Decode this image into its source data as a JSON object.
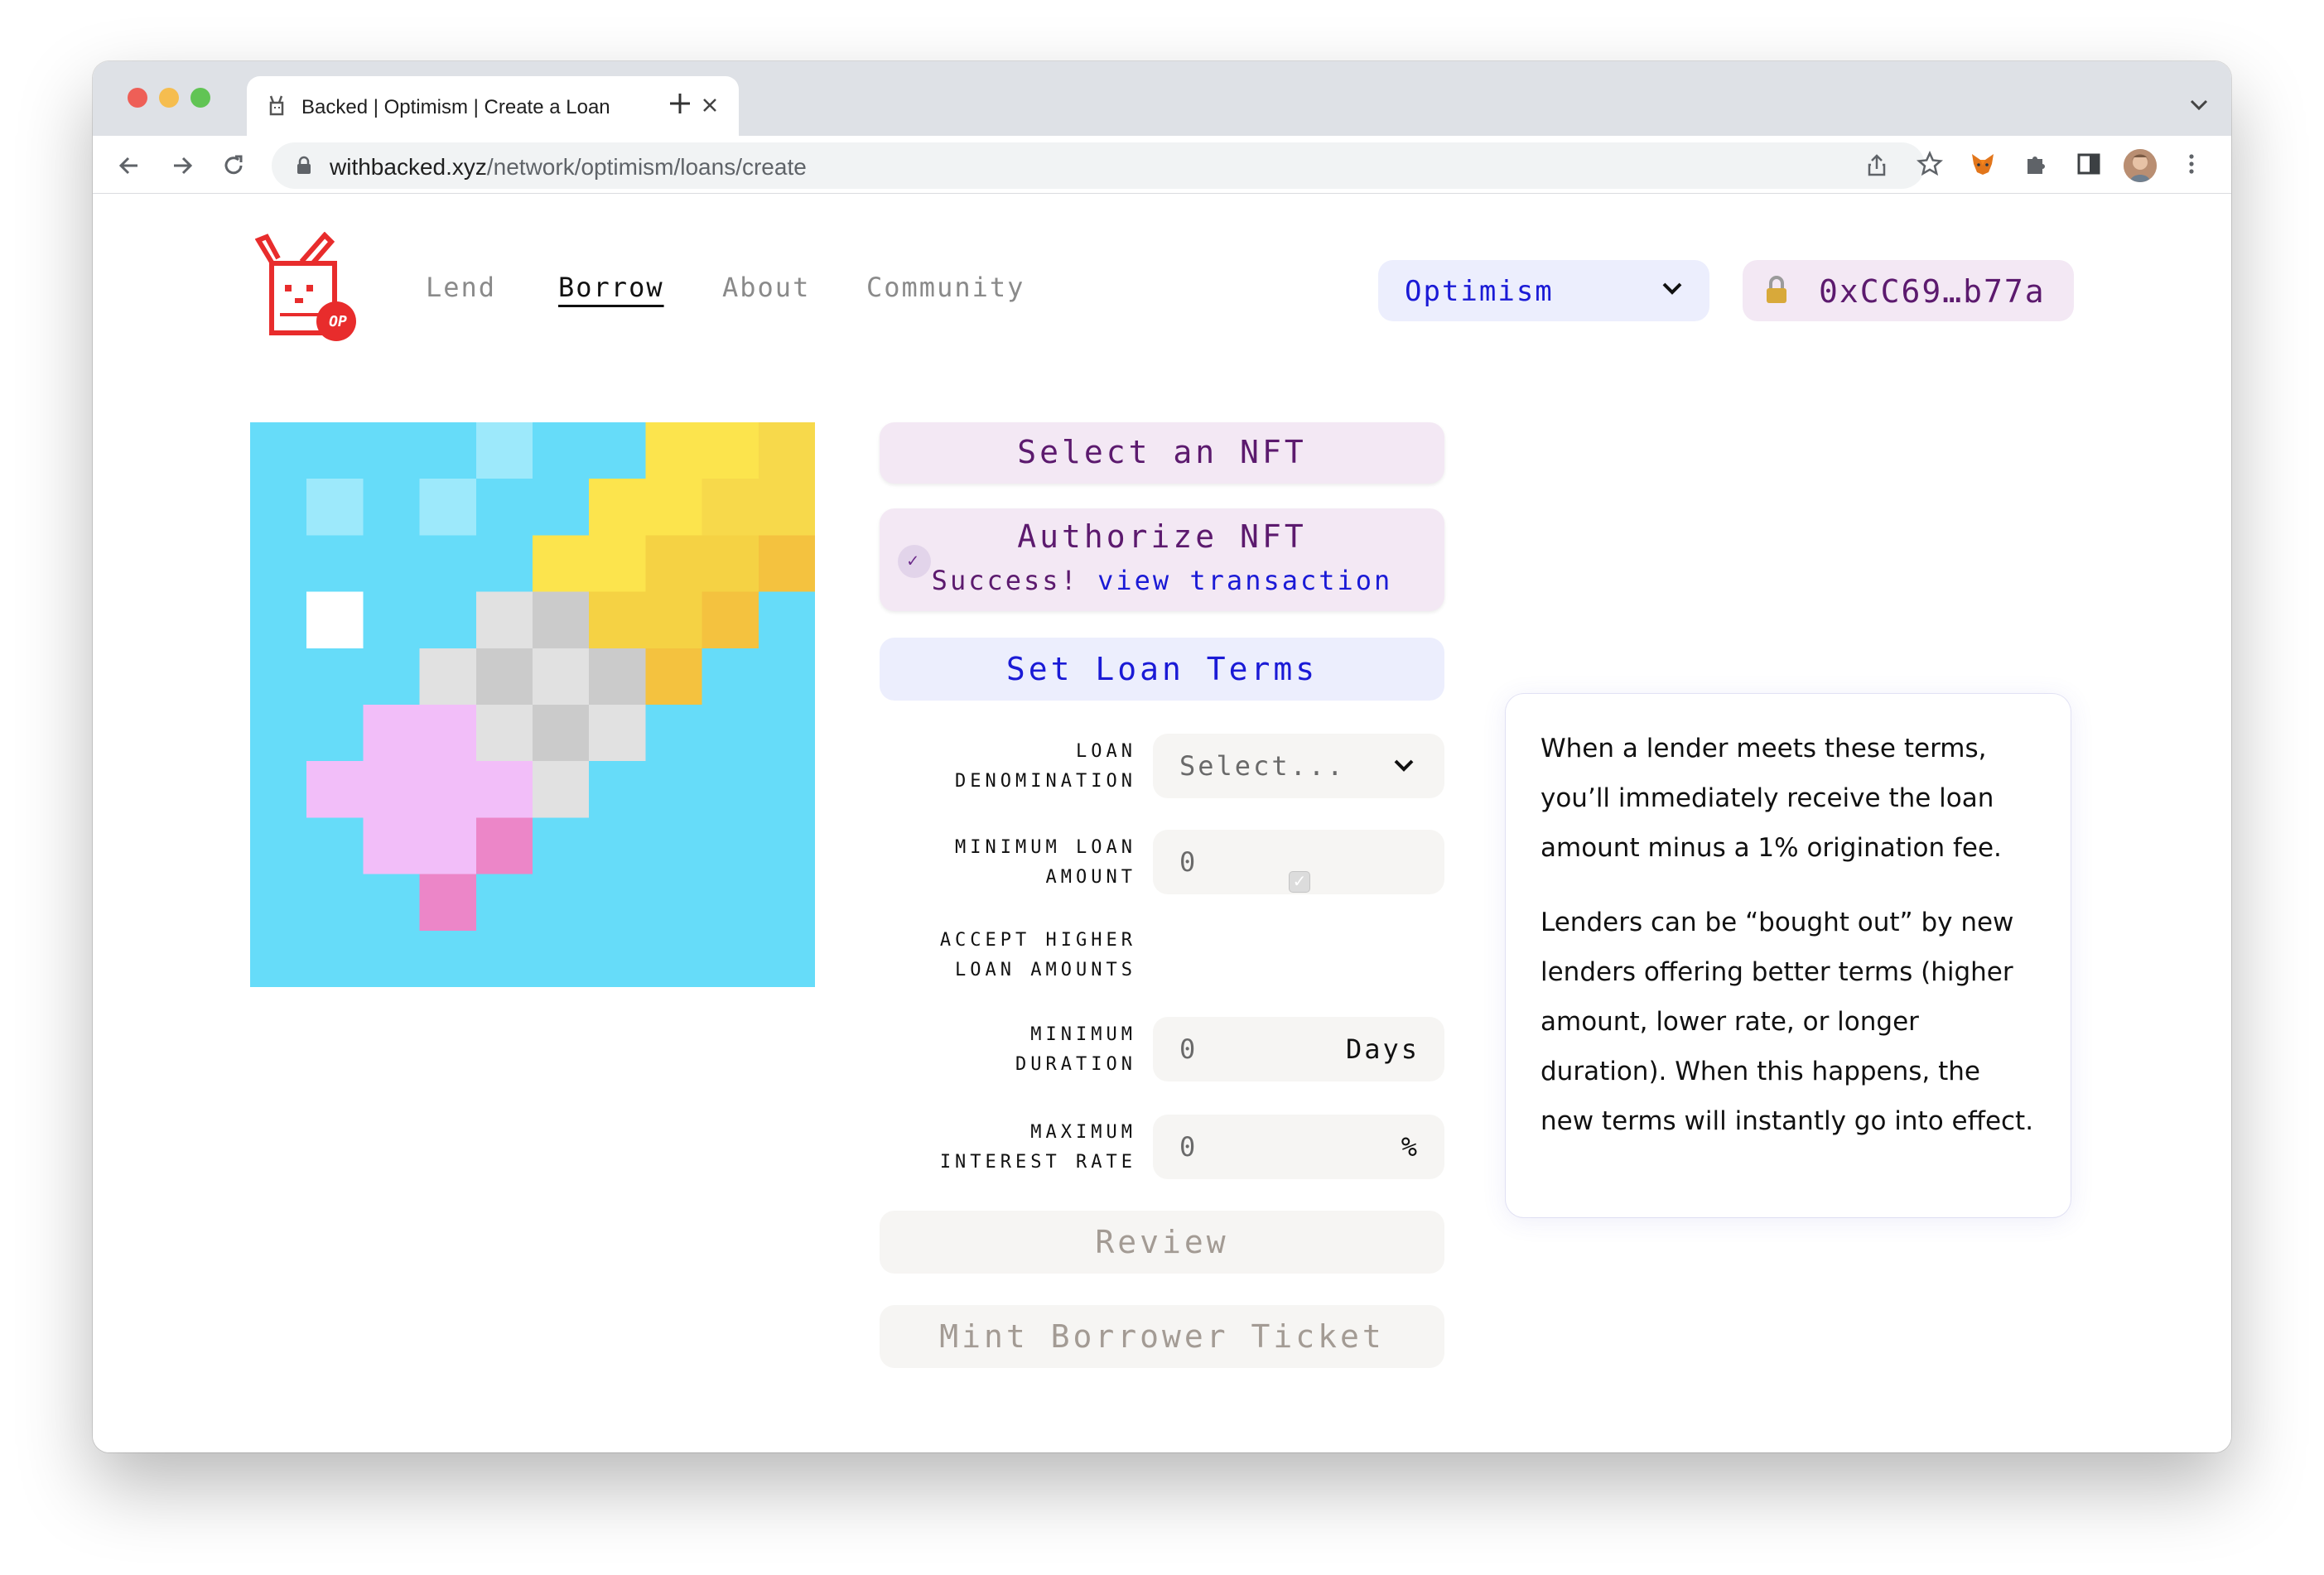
{
  "browser": {
    "tab_title": "Backed | Optimism | Create a Loan",
    "url_host": "withbacked.xyz",
    "url_path": "/network/optimism/loans/create"
  },
  "nav": {
    "links": [
      "Lend",
      "Borrow",
      "About",
      "Community"
    ],
    "active": "Borrow",
    "logo_badge": "OP"
  },
  "network_select": {
    "value": "Optimism"
  },
  "wallet": {
    "address": "0xCC69…b77a"
  },
  "steps": {
    "select_nft": "Select an NFT",
    "authorize_nft": "Authorize NFT",
    "authorize_status": "Success!",
    "authorize_link": "view transaction",
    "set_loan_terms": "Set Loan Terms",
    "review": "Review",
    "mint": "Mint Borrower Ticket"
  },
  "form": {
    "loan_denomination": {
      "label_1": "LOAN",
      "label_2": "DENOMINATION",
      "value": "Select..."
    },
    "minimum_loan_amount": {
      "label_1": "MINIMUM LOAN",
      "label_2": "AMOUNT",
      "value": "0"
    },
    "accept_higher": {
      "label_1": "ACCEPT HIGHER",
      "label_2": "LOAN AMOUNTS",
      "checked": true
    },
    "minimum_duration": {
      "label_1": "MINIMUM",
      "label_2": "DURATION",
      "value": "0",
      "unit": "Days"
    },
    "maximum_interest": {
      "label_1": "MAXIMUM",
      "label_2": "INTEREST RATE",
      "value": "0",
      "unit": "%"
    }
  },
  "info": {
    "p1": "When a lender meets these terms, you’ll immediately receive the loan amount minus a 1% origination fee.",
    "p2": "Lenders can be “bought out” by new lenders offering better terms (higher amount, lower rate, or longer duration). When this happens, the new terms will instantly go into effect."
  },
  "colors": {
    "accent_purple": "#5c1a6e",
    "accent_blue": "#1a1ad6",
    "nft_background": "#66dcf9"
  }
}
